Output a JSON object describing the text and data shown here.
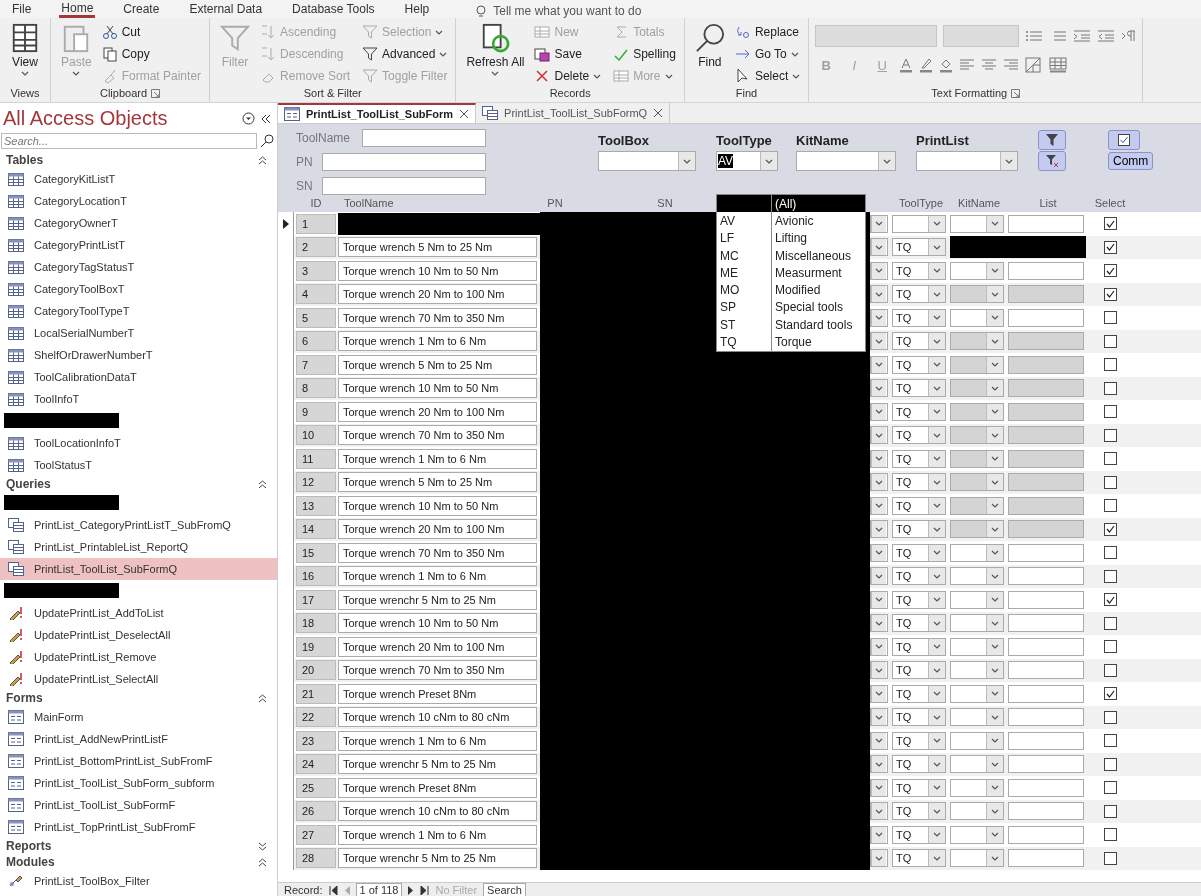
{
  "menu": [
    {
      "label": "File",
      "selected": false
    },
    {
      "label": "Home",
      "selected": true
    },
    {
      "label": "Create",
      "selected": false
    },
    {
      "label": "External Data",
      "selected": false
    },
    {
      "label": "Database Tools",
      "selected": false
    },
    {
      "label": "Help",
      "selected": false
    }
  ],
  "tell_me": {
    "placeholder": "Tell me what you want to do"
  },
  "ribbon": [
    {
      "label": "Views",
      "launcher": false,
      "items": [
        {
          "label": "View",
          "kind": "large",
          "disabled": false,
          "dropdown": true
        }
      ]
    },
    {
      "label": "Clipboard",
      "launcher": true,
      "items": [
        {
          "label": "Paste",
          "kind": "large",
          "disabled": true,
          "dropdown": true
        },
        {
          "label": "Cut",
          "kind": "small",
          "disabled": false,
          "dropdown": false
        },
        {
          "label": "Copy",
          "kind": "small",
          "disabled": false,
          "dropdown": false
        },
        {
          "label": "Format Painter",
          "kind": "small",
          "disabled": true,
          "dropdown": false
        }
      ]
    },
    {
      "label": "Sort & Filter",
      "launcher": false,
      "items": [
        {
          "label": "Filter",
          "kind": "large",
          "disabled": true,
          "dropdown": false
        },
        {
          "label": "Ascending",
          "kind": "small",
          "disabled": true,
          "dropdown": false
        },
        {
          "label": "Descending",
          "kind": "small",
          "disabled": true,
          "dropdown": false
        },
        {
          "label": "Remove Sort",
          "kind": "small",
          "disabled": true,
          "dropdown": false
        },
        {
          "label": "Selection",
          "kind": "small",
          "disabled": true,
          "dropdown": true
        },
        {
          "label": "Advanced",
          "kind": "small",
          "disabled": false,
          "dropdown": true
        },
        {
          "label": "Toggle Filter",
          "kind": "small",
          "disabled": true,
          "dropdown": false
        }
      ]
    },
    {
      "label": "Records",
      "launcher": false,
      "items": [
        {
          "label": "Refresh All",
          "kind": "large",
          "disabled": false,
          "dropdown": true
        },
        {
          "label": "New",
          "kind": "small",
          "disabled": true,
          "dropdown": false
        },
        {
          "label": "Save",
          "kind": "small",
          "disabled": false,
          "dropdown": false
        },
        {
          "label": "Delete",
          "kind": "small",
          "disabled": false,
          "dropdown": true
        },
        {
          "label": "Totals",
          "kind": "small",
          "disabled": true,
          "dropdown": false
        },
        {
          "label": "Spelling",
          "kind": "small",
          "disabled": false,
          "dropdown": false
        },
        {
          "label": "More",
          "kind": "small",
          "disabled": true,
          "dropdown": true
        }
      ]
    },
    {
      "label": "Find",
      "launcher": false,
      "items": [
        {
          "label": "Find",
          "kind": "large",
          "disabled": false,
          "dropdown": false
        },
        {
          "label": "Replace",
          "kind": "small",
          "disabled": false,
          "dropdown": false
        },
        {
          "label": "Go To",
          "kind": "small",
          "disabled": false,
          "dropdown": true
        },
        {
          "label": "Select",
          "kind": "small",
          "disabled": false,
          "dropdown": true
        }
      ]
    },
    {
      "label": "Text Formatting",
      "launcher": true,
      "items": [
        {
          "label": "B",
          "kind": "format",
          "disabled": true,
          "dropdown": false
        },
        {
          "label": "I",
          "kind": "format",
          "disabled": true,
          "dropdown": false
        },
        {
          "label": "U",
          "kind": "format",
          "disabled": true,
          "dropdown": false
        }
      ]
    }
  ],
  "nav": {
    "title": "All Access Objects",
    "search": {
      "placeholder": "Search..."
    },
    "sections": [
      {
        "label": "Tables",
        "expanded": true,
        "items": [
          {
            "kind": "table",
            "label": "CategoryKitListT",
            "selected": false
          },
          {
            "kind": "table",
            "label": "CategoryLocationT",
            "selected": false
          },
          {
            "kind": "table",
            "label": "CategoryOwnerT",
            "selected": false
          },
          {
            "kind": "table",
            "label": "CategoryPrintListT",
            "selected": false
          },
          {
            "kind": "table",
            "label": "CategoryTagStatusT",
            "selected": false
          },
          {
            "kind": "table",
            "label": "CategoryToolBoxT",
            "selected": false
          },
          {
            "kind": "table",
            "label": "CategoryToolTypeT",
            "selected": false
          },
          {
            "kind": "table",
            "label": "LocalSerialNumberT",
            "selected": false
          },
          {
            "kind": "table",
            "label": "ShelfOrDrawerNumberT",
            "selected": false
          },
          {
            "kind": "table",
            "label": "ToolCalibrationDataT",
            "selected": false
          },
          {
            "kind": "table",
            "label": "ToolInfoT",
            "selected": false
          },
          {
            "kind": "redacted"
          },
          {
            "kind": "table",
            "label": "ToolLocationInfoT",
            "selected": false
          },
          {
            "kind": "table",
            "label": "ToolStatusT",
            "selected": false
          }
        ]
      },
      {
        "label": "Queries",
        "expanded": true,
        "items": [
          {
            "kind": "redacted"
          },
          {
            "kind": "query",
            "label": "PrintList_CategoryPrintListT_SubFromQ",
            "selected": false
          },
          {
            "kind": "query",
            "label": "PrintList_PrintableList_ReportQ",
            "selected": false
          },
          {
            "kind": "query",
            "label": "PrintList_ToolList_SubFormQ",
            "selected": true
          },
          {
            "kind": "redacted"
          },
          {
            "kind": "action",
            "label": "UpdatePrintList_AddToList",
            "selected": false
          },
          {
            "kind": "action",
            "label": "UpdatePrintList_DeselectAll",
            "selected": false
          },
          {
            "kind": "action",
            "label": "UpdatePrintList_Remove",
            "selected": false
          },
          {
            "kind": "action",
            "label": "UpdatePrintList_SelectAll",
            "selected": false
          }
        ]
      },
      {
        "label": "Forms",
        "expanded": true,
        "items": [
          {
            "kind": "form",
            "label": "MainForm",
            "selected": false
          },
          {
            "kind": "form",
            "label": "PrintList_AddNewPrintListF",
            "selected": false
          },
          {
            "kind": "form",
            "label": "PrintList_BottomPrintList_SubFromF",
            "selected": false
          },
          {
            "kind": "form",
            "label": "PrintList_ToolList_SubForm_subform",
            "selected": false
          },
          {
            "kind": "form",
            "label": "PrintList_ToolList_SubFormF",
            "selected": false
          },
          {
            "kind": "form",
            "label": "PrintList_TopPrintList_SubFromF",
            "selected": false
          }
        ]
      },
      {
        "label": "Reports",
        "expanded": false
      },
      {
        "label": "Modules",
        "expanded": true,
        "items": [
          {
            "kind": "module",
            "label": "PrintList_ToolBox_Filter",
            "selected": false
          }
        ]
      }
    ]
  },
  "doc_tabs": [
    {
      "label": "PrintList_ToolList_SubForm",
      "kind": "form",
      "selected": true
    },
    {
      "label": "PrintList_ToolList_SubFormQ",
      "kind": "query",
      "selected": false
    }
  ],
  "filters": {
    "toolname_label": "ToolName",
    "pn_label": "PN",
    "sn_label": "SN",
    "toolbox_label": "ToolBox",
    "tooltype_label": "ToolType",
    "tooltype_value": "AV",
    "kitname_label": "KitName",
    "printlist_label": "PrintList",
    "comm_button": "Comm"
  },
  "tooltype_dropdown": [
    {
      "name": "(All)",
      "selected": true
    },
    {
      "code": "AV",
      "name": "Avionic",
      "selected": false
    },
    {
      "code": "LF",
      "name": "Lifting",
      "selected": false
    },
    {
      "code": "MC",
      "name": "Miscellaneous",
      "selected": false
    },
    {
      "code": "ME",
      "name": "Measurment",
      "selected": false
    },
    {
      "code": "MO",
      "name": "Modified",
      "selected": false
    },
    {
      "code": "SP",
      "name": "Special tools",
      "selected": false
    },
    {
      "code": "ST",
      "name": "Standard tools",
      "selected": false
    },
    {
      "code": "TQ",
      "name": "Torque",
      "selected": false
    }
  ],
  "table": {
    "columns": [
      "ID",
      "ToolName",
      "PN",
      "SN",
      "ToolType",
      "KitName",
      "List",
      "Select"
    ],
    "redacted": true,
    "rows": [
      {
        "number": "1",
        "current": true,
        "name_redacted": true,
        "locked": false,
        "checked": true
      },
      {
        "number": "2",
        "current": false,
        "name": "Torque wrench 5 Nm to 25 Nm",
        "tooltype": "TQ",
        "kit_redacted": true,
        "checked": true
      },
      {
        "number": "3",
        "current": false,
        "name": "Torque wrench 10 Nm to 50 Nm",
        "tooltype": "TQ",
        "locked": false,
        "checked": true
      },
      {
        "number": "4",
        "current": false,
        "name": "Torque wrench 20 Nm to 100 Nm",
        "tooltype": "TQ",
        "locked": true,
        "checked": true
      },
      {
        "number": "5",
        "current": false,
        "name": "Torque wrench 70 Nm to 350 Nm",
        "tooltype": "TQ",
        "locked": false,
        "checked": false
      },
      {
        "number": "6",
        "current": false,
        "name": "Torque wrench 1 Nm to 6 Nm",
        "tooltype": "TQ",
        "locked": true,
        "checked": false
      },
      {
        "number": "7",
        "current": false,
        "name": "Torque wrench 5 Nm to 25 Nm",
        "tooltype": "TQ",
        "locked": true,
        "checked": false
      },
      {
        "number": "8",
        "current": false,
        "name": "Torque wrench 10 Nm to 50 Nm",
        "tooltype": "TQ",
        "locked": true,
        "checked": false
      },
      {
        "number": "9",
        "current": false,
        "name": "Torque wrench 20 Nm to 100 Nm",
        "tooltype": "TQ",
        "locked": true,
        "checked": false
      },
      {
        "number": "10",
        "current": false,
        "name": "Torque wrench 70 Nm to 350 Nm",
        "tooltype": "TQ",
        "locked": true,
        "checked": false
      },
      {
        "number": "11",
        "current": false,
        "name": "Torque wrench 1 Nm to 6 Nm",
        "tooltype": "TQ",
        "locked": true,
        "checked": false
      },
      {
        "number": "12",
        "current": false,
        "name": "Torque wrench 5 Nm to 25 Nm",
        "tooltype": "TQ",
        "locked": true,
        "checked": false
      },
      {
        "number": "13",
        "current": false,
        "name": "Torque wrench 10 Nm to 50 Nm",
        "tooltype": "TQ",
        "locked": true,
        "checked": false
      },
      {
        "number": "14",
        "current": false,
        "name": "Torque wrench 20 Nm to 100 Nm",
        "tooltype": "TQ",
        "locked": true,
        "checked": true
      },
      {
        "number": "15",
        "current": false,
        "name": "Torque wrench 70 Nm to 350 Nm",
        "tooltype": "TQ",
        "locked": false,
        "checked": false
      },
      {
        "number": "16",
        "current": false,
        "name": "Torque wrench 1 Nm to 6 Nm",
        "tooltype": "TQ",
        "locked": false,
        "checked": false
      },
      {
        "number": "17",
        "current": false,
        "name": "Torque wrenchr 5 Nm to 25 Nm",
        "tooltype": "TQ",
        "locked": false,
        "checked": true
      },
      {
        "number": "18",
        "current": false,
        "name": "Torque wrench 10 Nm to 50 Nm",
        "tooltype": "TQ",
        "locked": false,
        "checked": false
      },
      {
        "number": "19",
        "current": false,
        "name": "Torque wrench 20 Nm to 100 Nm",
        "tooltype": "TQ",
        "locked": false,
        "checked": false
      },
      {
        "number": "20",
        "current": false,
        "name": "Torque wrench 70 Nm to 350 Nm",
        "tooltype": "TQ",
        "locked": false,
        "checked": false
      },
      {
        "number": "21",
        "current": false,
        "name": "Torque wrench Preset 8Nm",
        "tooltype": "TQ",
        "locked": false,
        "checked": true
      },
      {
        "number": "22",
        "current": false,
        "name": "Torque wrench 10 cNm to 80 cNm",
        "tooltype": "TQ",
        "locked": false,
        "checked": false
      },
      {
        "number": "23",
        "current": false,
        "name": "Torque wrench 1 Nm to 6 Nm",
        "tooltype": "TQ",
        "locked": false,
        "checked": false
      },
      {
        "number": "24",
        "current": false,
        "name": "Torque wrenchr 5 Nm to 25 Nm",
        "tooltype": "TQ",
        "locked": false,
        "checked": false
      },
      {
        "number": "25",
        "current": false,
        "name": "Torque wrench Preset 8Nm",
        "tooltype": "TQ",
        "locked": false,
        "checked": false
      },
      {
        "number": "26",
        "current": false,
        "name": "Torque wrench 10 cNm to 80 cNm",
        "tooltype": "TQ",
        "locked": false,
        "checked": false
      },
      {
        "number": "27",
        "current": false,
        "name": "Torque wrench 1 Nm to 6 Nm",
        "tooltype": "TQ",
        "locked": false,
        "checked": false
      },
      {
        "number": "28",
        "current": false,
        "name": "Torque wrenchr 5 Nm to 25 Nm",
        "tooltype": "TQ",
        "locked": false,
        "checked": false
      }
    ]
  },
  "status_bar": {
    "record_label": "Record:",
    "position": "1 of 118",
    "filter": "No Filter",
    "search": "Search"
  }
}
